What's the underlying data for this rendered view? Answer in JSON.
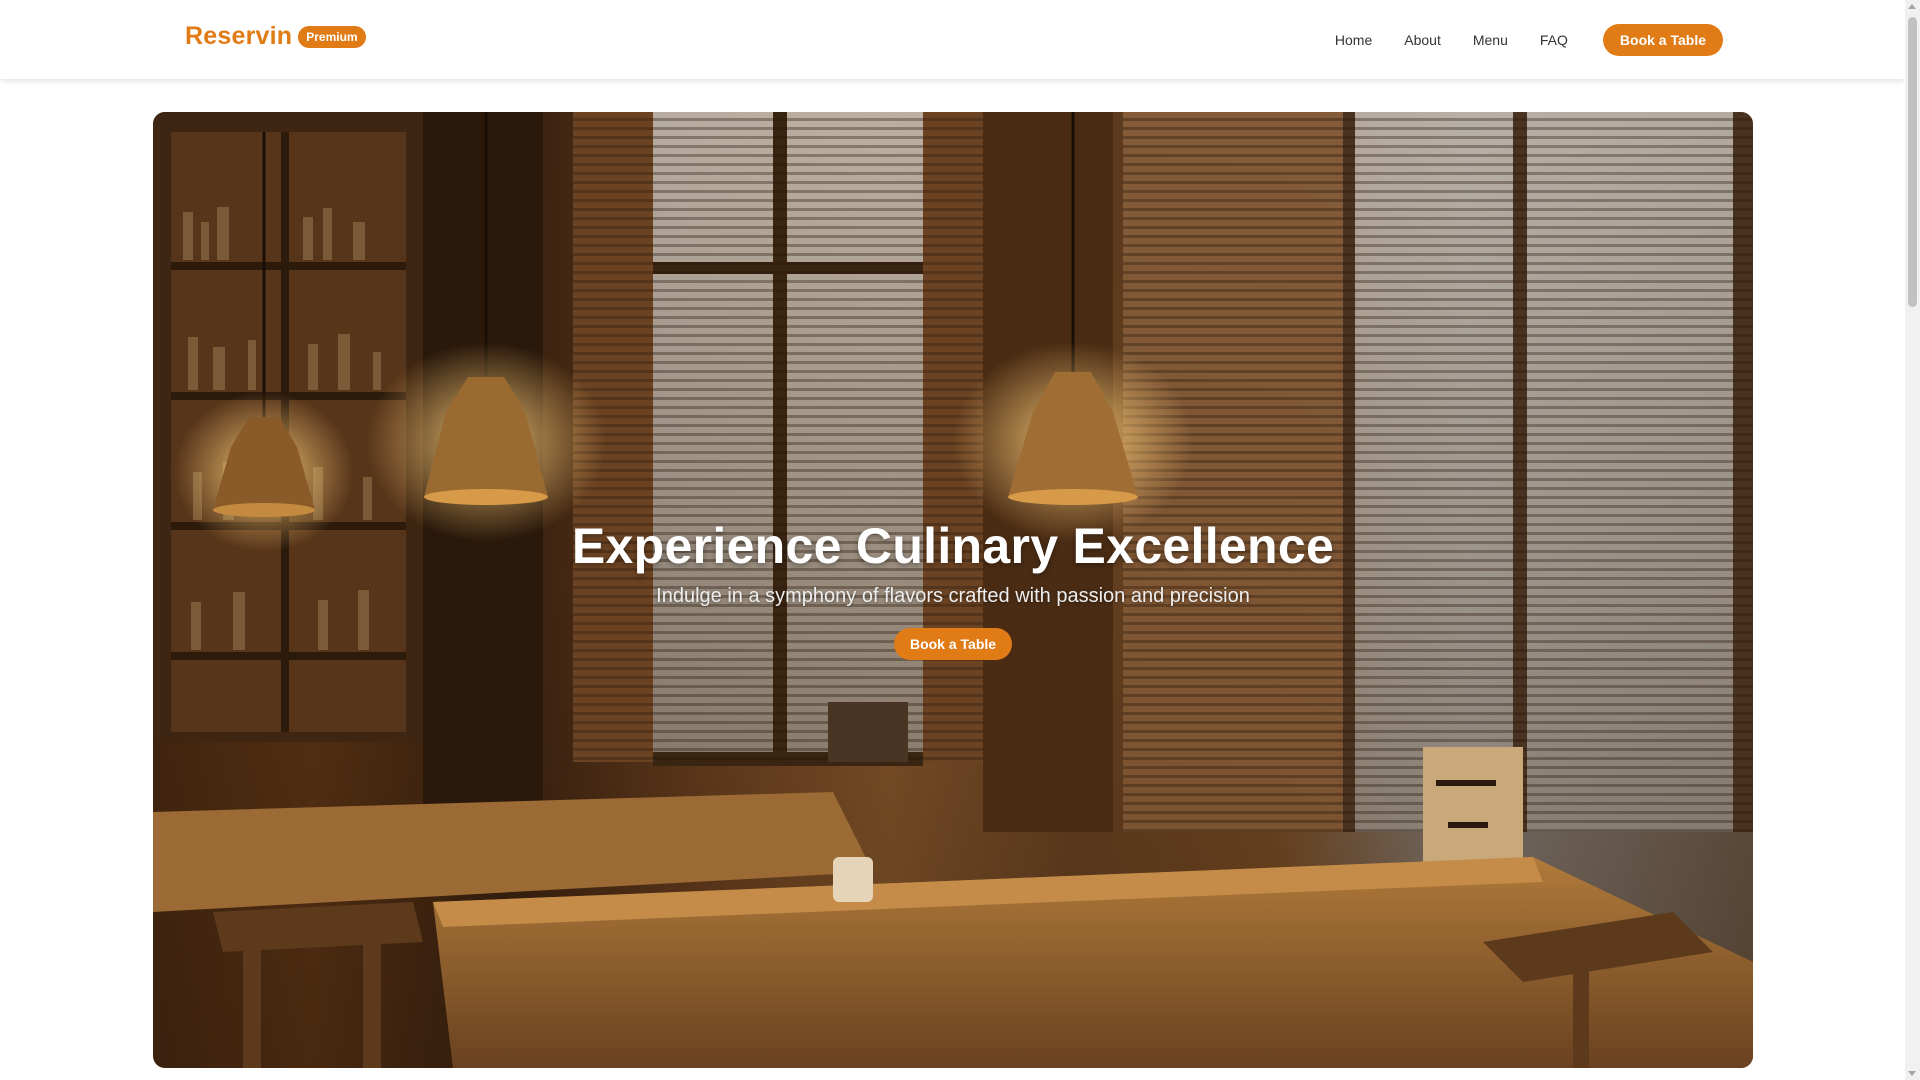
{
  "brand": {
    "name": "Reservin",
    "badge": "Premium",
    "accent_color": "#e07b16"
  },
  "nav": {
    "links": [
      "Home",
      "About",
      "Menu",
      "FAQ"
    ],
    "cta_label": "Book a Table"
  },
  "hero": {
    "title": "Experience Culinary Excellence",
    "subtitle": "Indulge in a symphony of flavors crafted with passion and precision",
    "cta_label": "Book a Table",
    "image": "restaurant-interior-photo"
  },
  "scrollbar": {
    "icon_up": "chevron-up-icon",
    "icon_down": "chevron-down-icon"
  }
}
